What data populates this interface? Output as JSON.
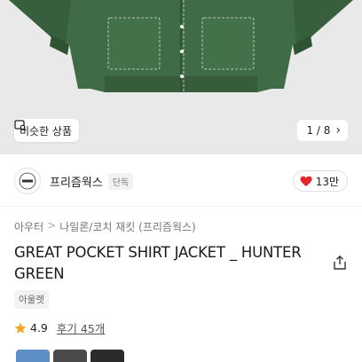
{
  "gallery": {
    "similar_label": "비슷한 상품",
    "similar_icon": "image-search-icon",
    "page_indicator": "1 / 8",
    "next_icon": "chevron-right-icon"
  },
  "brand": {
    "name": "프리즘웍스",
    "badge": "단독",
    "logo_icon": "brand-logo-icon"
  },
  "likes": {
    "count": "13만",
    "icon": "heart-icon",
    "color": "#e5262b"
  },
  "breadcrumb": {
    "category": "아우터",
    "separator": ">",
    "subcategory": "나일론/코치 재킷 (프리즘웍스)"
  },
  "product": {
    "title": "GREAT POCKET SHIRT JACKET _ HUNTER GREEN",
    "tag": "아울렛",
    "share_icon": "share-icon"
  },
  "rating": {
    "score": "4.9",
    "reviews": "후기 45개",
    "star_color": "#f5a623"
  },
  "colors": {
    "jacket": "#3f6b46",
    "thumb_variants": [
      "#5d8fc6",
      "#4a4a4a",
      "#2b2b2b"
    ]
  }
}
